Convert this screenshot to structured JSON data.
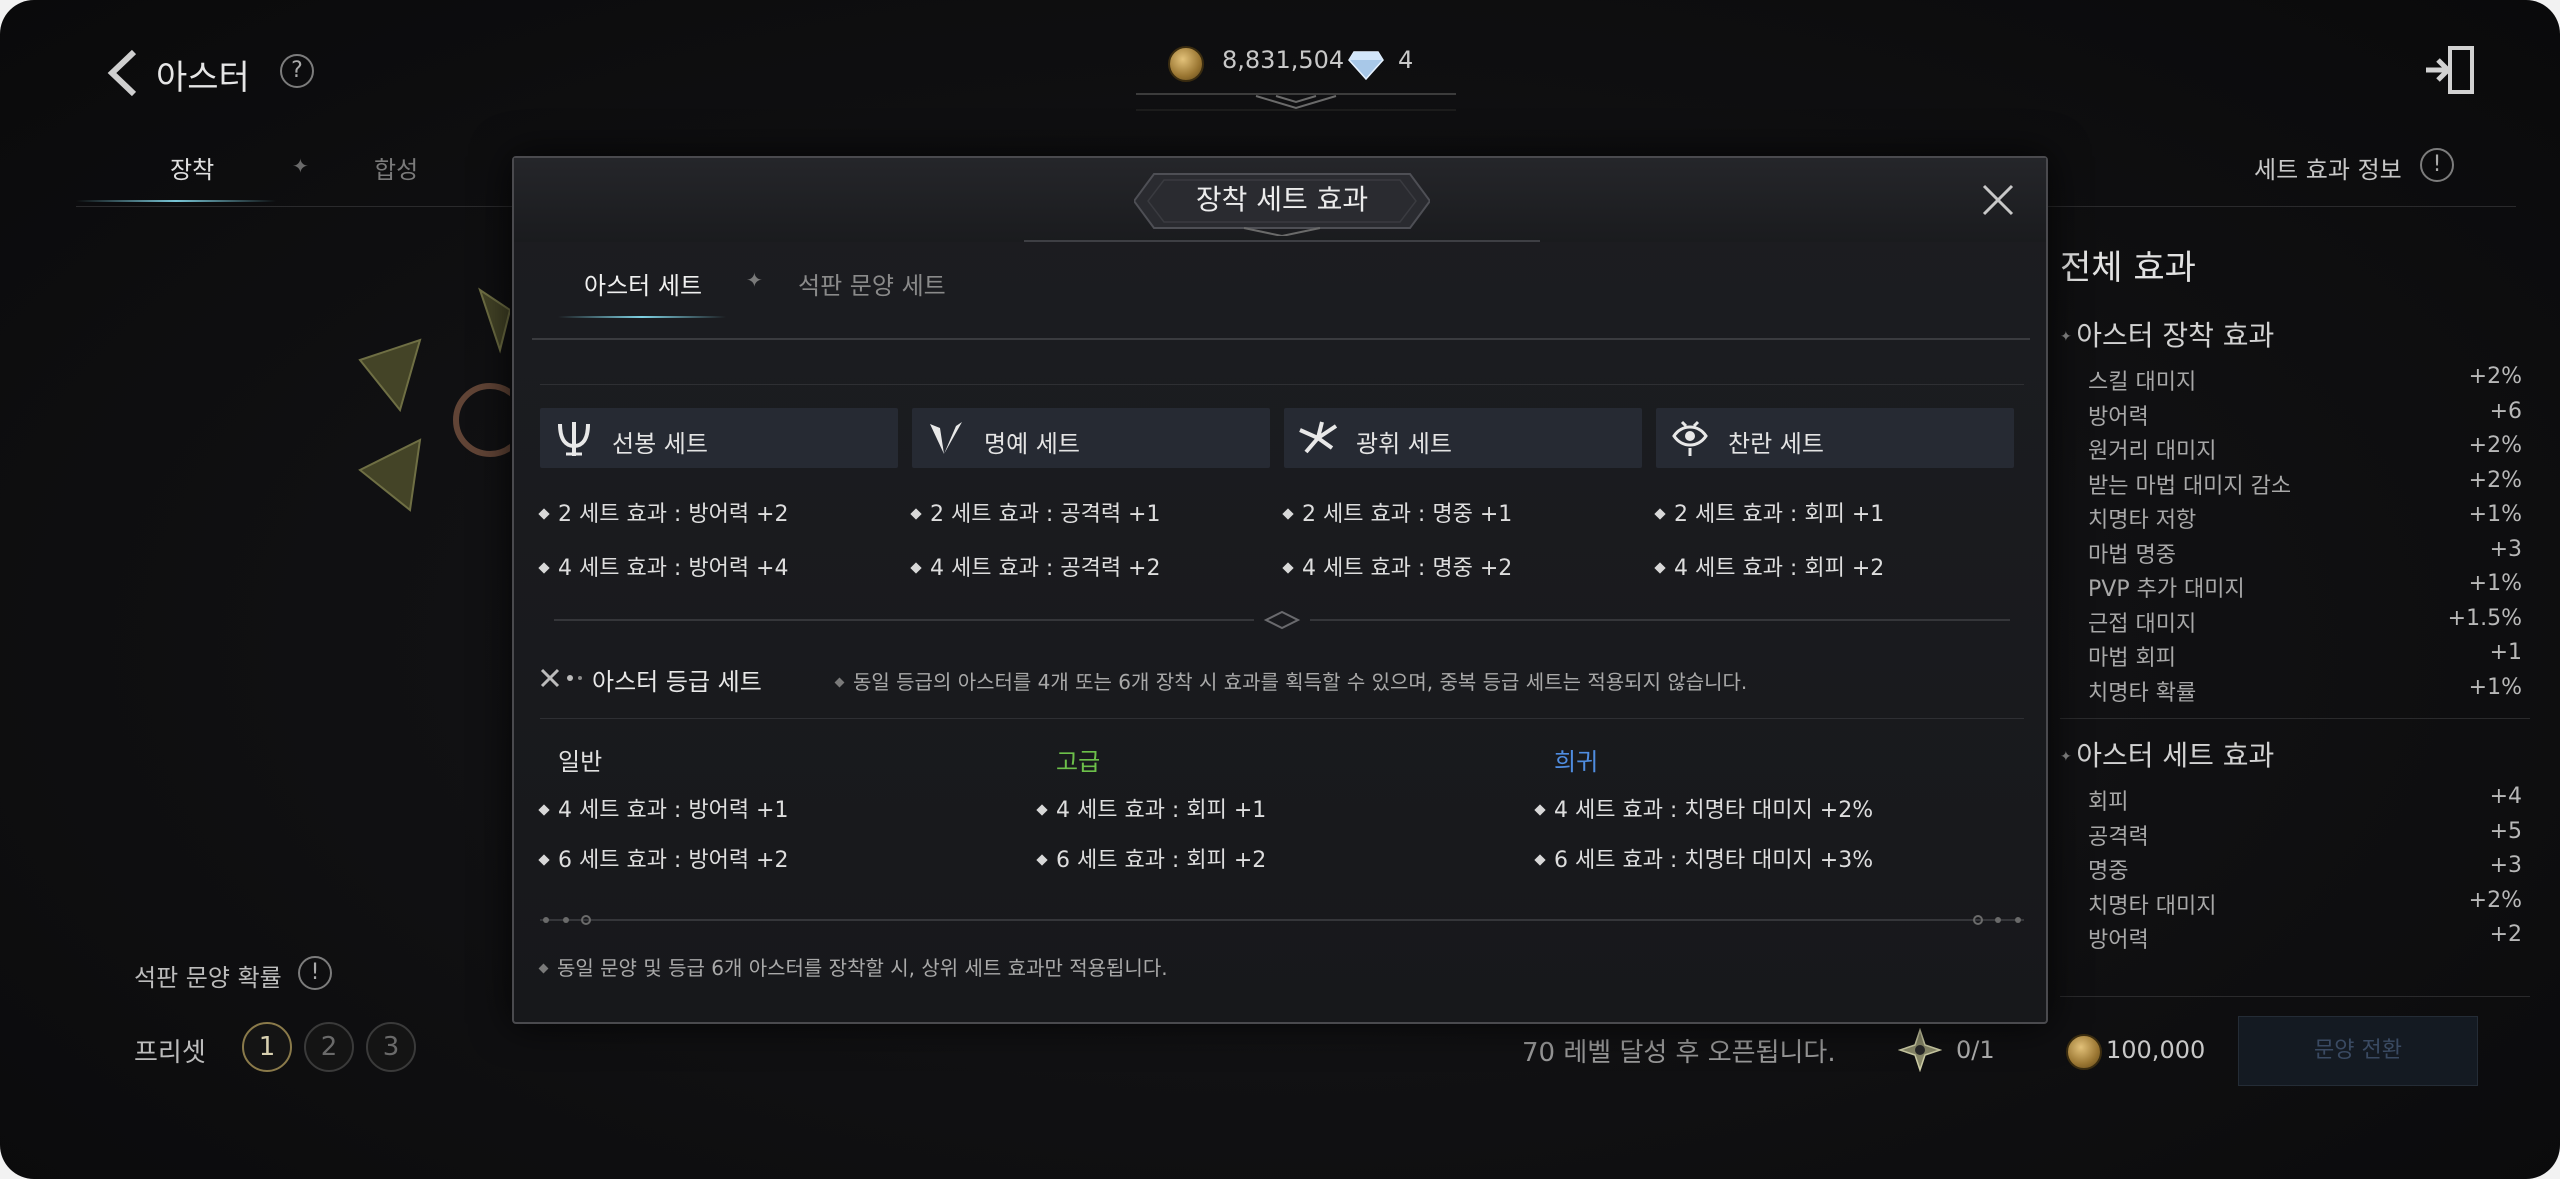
{
  "header": {
    "title": "아스터",
    "help": "?",
    "gold": "8,831,504",
    "gems": "4"
  },
  "bg_tabs": [
    {
      "label": "장착"
    },
    {
      "label": "합성"
    }
  ],
  "right_panel": {
    "info_label": "세트 효과 정보",
    "info_icon": "!",
    "title": "전체 효과",
    "section1_title": "아스터 장착 효과",
    "section1_rows": [
      {
        "name": "스킬 대미지",
        "value": "+2%"
      },
      {
        "name": "방어력",
        "value": "+6"
      },
      {
        "name": "원거리 대미지",
        "value": "+2%"
      },
      {
        "name": "받는 마법 대미지 감소",
        "value": "+2%"
      },
      {
        "name": "치명타 저항",
        "value": "+1%"
      },
      {
        "name": "마법 명중",
        "value": "+3"
      },
      {
        "name": "PVP 추가 대미지",
        "value": "+1%"
      },
      {
        "name": "근접 대미지",
        "value": "+1.5%"
      },
      {
        "name": "마법 회피",
        "value": "+1"
      },
      {
        "name": "치명타 확률",
        "value": "+1%"
      }
    ],
    "section2_title": "아스터 세트 효과",
    "section2_rows": [
      {
        "name": "회피",
        "value": "+4"
      },
      {
        "name": "공격력",
        "value": "+5"
      },
      {
        "name": "명중",
        "value": "+3"
      },
      {
        "name": "치명타 대미지",
        "value": "+2%"
      },
      {
        "name": "방어력",
        "value": "+2"
      }
    ]
  },
  "left_bottom": {
    "probability_label": "석판 문양 확률",
    "probability_icon": "!",
    "preset_label": "프리셋",
    "presets": [
      "1",
      "2",
      "3"
    ]
  },
  "bottom_bar": {
    "unlock_message": "70 레벨 달성 후 오픈됩니다.",
    "count": "0/1",
    "cost": "100,000",
    "switch_button": "문양 전환"
  },
  "modal": {
    "title": "장착 세트 효과",
    "tabs": [
      {
        "label": "아스터 세트",
        "active": true
      },
      {
        "label": "석판 문양 세트",
        "active": false
      }
    ],
    "sets": [
      {
        "name": "선봉 세트",
        "icon": "vanguard-icon",
        "effects": [
          "2 세트 효과 : 방어력 +2",
          "4 세트 효과 : 방어력 +4"
        ]
      },
      {
        "name": "명예 세트",
        "icon": "honor-icon",
        "effects": [
          "2 세트 효과 : 공격력 +1",
          "4 세트 효과 : 공격력 +2"
        ]
      },
      {
        "name": "광휘 세트",
        "icon": "radiance-icon",
        "effects": [
          "2 세트 효과 : 명중 +1",
          "4 세트 효과 : 명중 +2"
        ]
      },
      {
        "name": "찬란 세트",
        "icon": "brilliance-icon",
        "effects": [
          "2 세트 효과 : 회피 +1",
          "4 세트 효과 : 회피 +2"
        ]
      }
    ],
    "grade_set_title": "아스터 등급 세트",
    "grade_set_note": "동일 등급의 아스터를 4개 또는 6개 장착 시 효과를 획득할 수 있으며, 중복 등급 세트는 적용되지 않습니다.",
    "grades": [
      {
        "name": "일반",
        "color": "#e0e0e0",
        "effects": [
          "4 세트 효과 : 방어력 +1",
          "6 세트 효과 : 방어력 +2"
        ]
      },
      {
        "name": "고급",
        "color": "#6cc04a",
        "effects": [
          "4 세트 효과 : 회피 +1",
          "6 세트 효과 : 회피 +2"
        ]
      },
      {
        "name": "희귀",
        "color": "#4f8de0",
        "effects": [
          "4 세트 효과 : 치명타 대미지 +2%",
          "6 세트 효과 : 치명타 대미지 +3%"
        ]
      }
    ],
    "footer_note": "동일 문양 및 등급 6개 아스터를 장착할 시, 상위 세트 효과만 적용됩니다."
  }
}
